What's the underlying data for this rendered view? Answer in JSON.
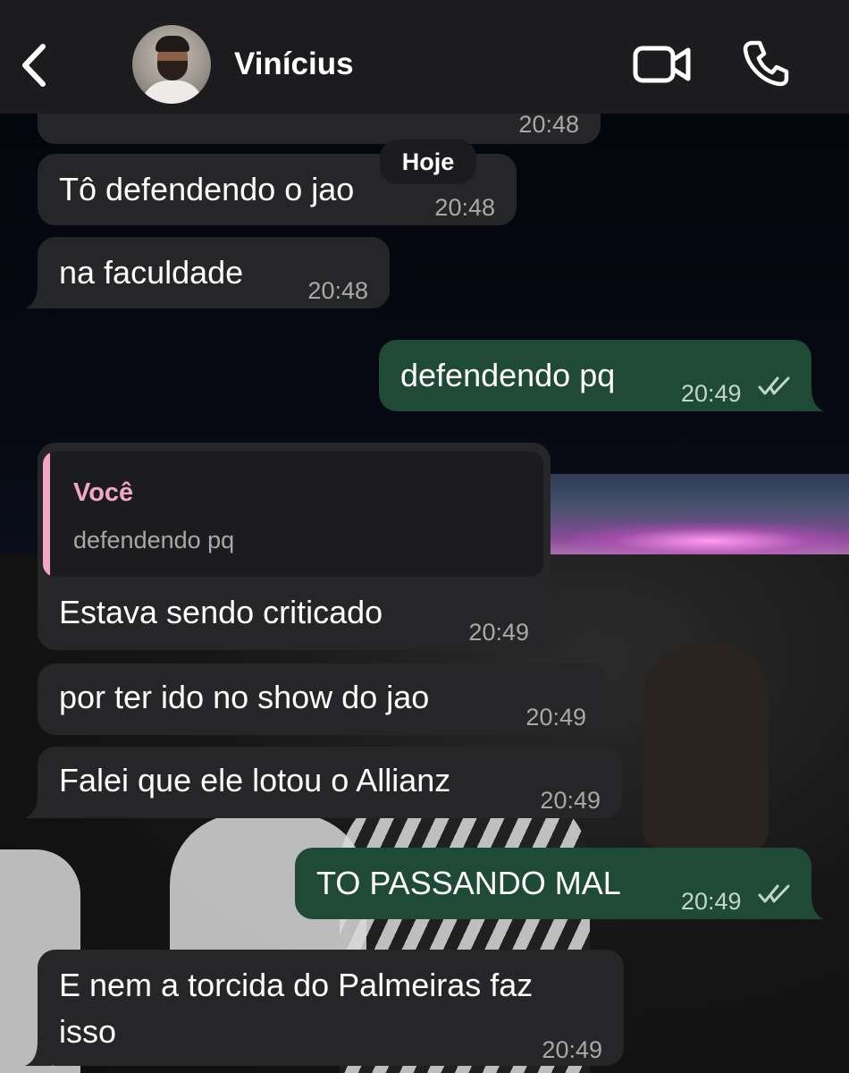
{
  "header": {
    "back_icon": "chevron-left-icon",
    "contact_name": "Vinícius",
    "video_icon": "video-camera-icon",
    "call_icon": "phone-icon"
  },
  "date_separator": "Hoje",
  "messages": [
    {
      "direction": "incoming",
      "text": "",
      "time": "20:48"
    },
    {
      "direction": "incoming",
      "text": "Tô defendendo o jao",
      "time": "20:48"
    },
    {
      "direction": "incoming",
      "text": "na faculdade",
      "time": "20:48"
    },
    {
      "direction": "outgoing",
      "text": "defendendo pq",
      "time": "20:49",
      "status": "read"
    },
    {
      "direction": "incoming",
      "reply_to": {
        "author": "Você",
        "text": "defendendo pq"
      },
      "text": "Estava sendo criticado",
      "time": "20:49"
    },
    {
      "direction": "incoming",
      "text": "por ter ido no show do jao",
      "time": "20:49"
    },
    {
      "direction": "incoming",
      "text": "Falei que ele lotou o Allianz",
      "time": "20:49"
    },
    {
      "direction": "outgoing",
      "text": "TO PASSANDO MAL",
      "time": "20:49",
      "status": "read"
    },
    {
      "direction": "incoming",
      "text_lines": [
        "E nem a torcida do Palmeiras faz",
        "isso"
      ],
      "time": "20:49"
    }
  ],
  "colors": {
    "header_bg": "#1c1c1e",
    "incoming_bubble": "#262628",
    "outgoing_bubble": "#1f4a35",
    "quote_accent": "#f2a7c4"
  }
}
